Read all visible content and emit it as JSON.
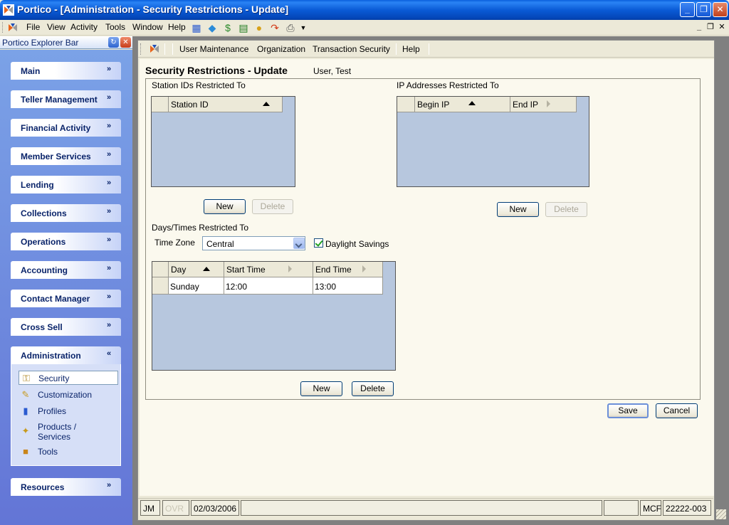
{
  "window": {
    "title": "Portico - [Administration - Security Restrictions - Update]",
    "minimize": "_",
    "maximize": "❐",
    "close": "✕"
  },
  "menu": {
    "items": [
      "File",
      "View",
      "Activity",
      "Tools",
      "Window",
      "Help"
    ],
    "toolbar_icons": [
      "teller-icon",
      "card-icon",
      "money-icon",
      "cash-icon",
      "bag-icon",
      "redo-icon",
      "print-icon"
    ],
    "mdi_minimize": "_",
    "mdi_restore": "❐",
    "mdi_close": "✕"
  },
  "explorer": {
    "title": "Portico Explorer Bar",
    "groups": [
      "Main",
      "Teller Management",
      "Financial Activity",
      "Member Services",
      "Lending",
      "Collections",
      "Operations",
      "Accounting",
      "Contact Manager",
      "Cross Sell",
      "Administration",
      "Resources"
    ],
    "admin_tasks": [
      "Security",
      "Customization",
      "Profiles",
      "Products / Services",
      "Tools"
    ]
  },
  "child_toolbar": {
    "items": [
      "User Maintenance",
      "Organization",
      "Transaction Security",
      "Help"
    ]
  },
  "form": {
    "title": "Security Restrictions - Update",
    "user": "User, Test",
    "stations": {
      "label": "Station IDs Restricted To",
      "column": "Station ID",
      "new": "New",
      "delete": "Delete"
    },
    "ips": {
      "label": "IP Addresses Restricted To",
      "col_begin": "Begin IP",
      "col_end": "End IP",
      "new": "New",
      "delete": "Delete"
    },
    "days": {
      "label": "Days/Times Restricted To",
      "timezone_label": "Time Zone",
      "timezone_value": "Central",
      "daylight_label": "Daylight Savings",
      "daylight_checked": true,
      "col_day": "Day",
      "col_start": "Start Time",
      "col_end": "End Time",
      "rows": [
        {
          "day": "Sunday",
          "start": "12:00",
          "end": "13:00"
        }
      ],
      "new": "New",
      "delete": "Delete"
    },
    "save": "Save",
    "cancel": "Cancel"
  },
  "status": {
    "user": "JM",
    "ovr": "OVR",
    "date": "02/03/2006",
    "mcf": "MCF",
    "code": "22222-003"
  }
}
